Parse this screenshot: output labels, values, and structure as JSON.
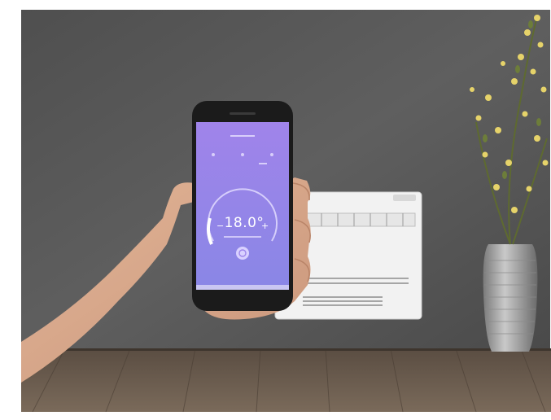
{
  "photo": {
    "subject": "hand-holding-smartphone-thermostat-app",
    "colors": {
      "wall": "#5b5b5b",
      "floor": "#6b5a4a",
      "app_gradient_top": "#9a7ee6",
      "app_gradient_bottom": "#8f88e8",
      "heater": "#f1f1f1",
      "vase": "#a8a8a8",
      "flowers": "#e8d66a",
      "leaves": "#6f7f3a",
      "skin": "#d9a98b"
    }
  },
  "phone": {
    "screen": {
      "temperature_display": "18.0°",
      "dial_label": "thermostat-dial"
    }
  },
  "icons": {
    "power": "power-icon",
    "minus": "minus-icon",
    "plus": "plus-icon"
  }
}
